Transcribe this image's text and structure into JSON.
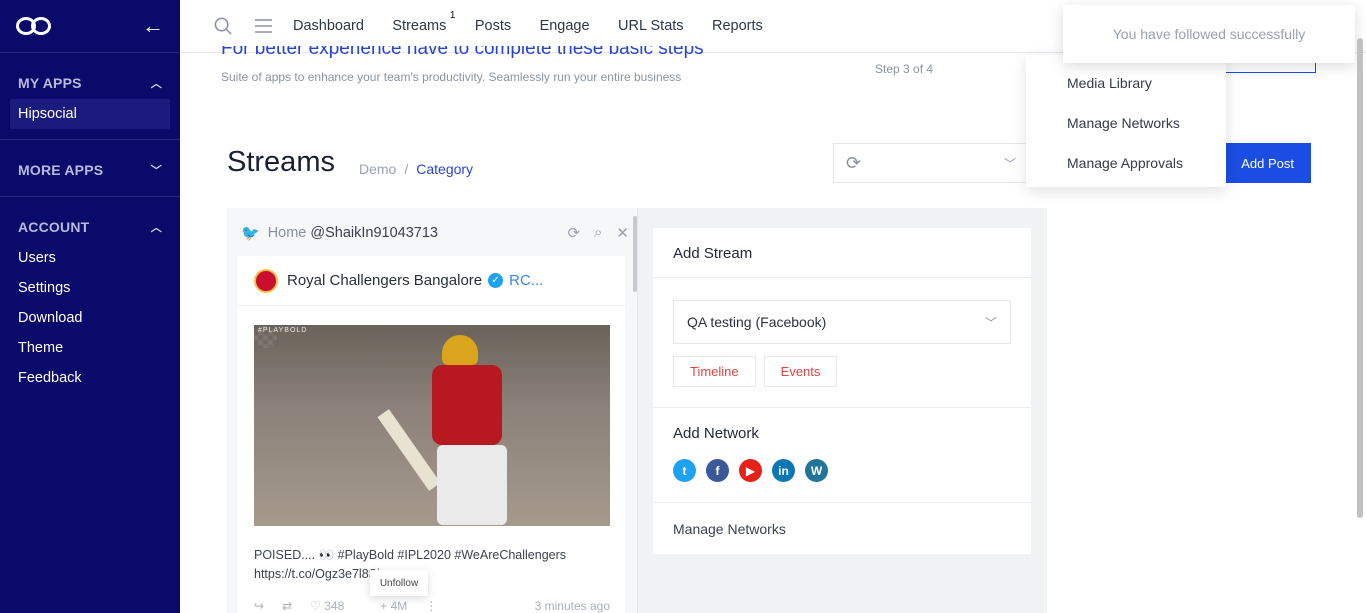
{
  "sidebar": {
    "sections": [
      {
        "title": "MY APPS",
        "items": [
          "Hipsocial"
        ]
      },
      {
        "title": "MORE APPS",
        "items": []
      },
      {
        "title": "ACCOUNT",
        "items": [
          "Users",
          "Settings",
          "Download",
          "Theme",
          "Feedback"
        ]
      }
    ]
  },
  "nav": {
    "items": [
      "Dashboard",
      "Streams",
      "Posts",
      "Engage",
      "URL Stats",
      "Reports"
    ],
    "streams_badge": "1"
  },
  "banner": {
    "title": "For better experience have to complete these basic steps",
    "subtitle": "Suite of apps to enhance your team's productivity. Seamlessly run your entire business",
    "step": "Step 3 of 4"
  },
  "page": {
    "title": "Streams",
    "crumb_root": "Demo",
    "crumb_sep": "/",
    "crumb_current": "Category"
  },
  "add_post_label": "Add Post",
  "menu": {
    "items": [
      "Media Library",
      "Manage Networks",
      "Manage Approvals"
    ]
  },
  "toast": "You have followed successfully",
  "stream": {
    "header_label": "Home",
    "header_handle": "@ShaikIn91043713",
    "author": "Royal Challengers Bangalore",
    "author_handle": "RC...",
    "photo_tag": "#PLAYBOLD",
    "caption": "POISED.... 👀 #PlayBold #IPL2020 #WeAreChallengers https://t.co/Ogz3e7l8Si",
    "tooltip": "Unfollow",
    "likes": "348",
    "followers": "+ 4M",
    "time": "3 minutes ago"
  },
  "panel": {
    "add_stream_title": "Add Stream",
    "selected_account": "QA testing (Facebook)",
    "chips": [
      "Timeline",
      "Events"
    ],
    "add_network_title": "Add Network",
    "networks": [
      {
        "name": "twitter-icon",
        "letter": "t",
        "color": "#1da1f2"
      },
      {
        "name": "facebook-icon",
        "letter": "f",
        "color": "#3b5998"
      },
      {
        "name": "youtube-icon",
        "letter": "▶",
        "color": "#e62117"
      },
      {
        "name": "linkedin-icon",
        "letter": "in",
        "color": "#0a77b5"
      },
      {
        "name": "wordpress-icon",
        "letter": "W",
        "color": "#21759b"
      }
    ],
    "manage_networks": "Manage Networks"
  }
}
